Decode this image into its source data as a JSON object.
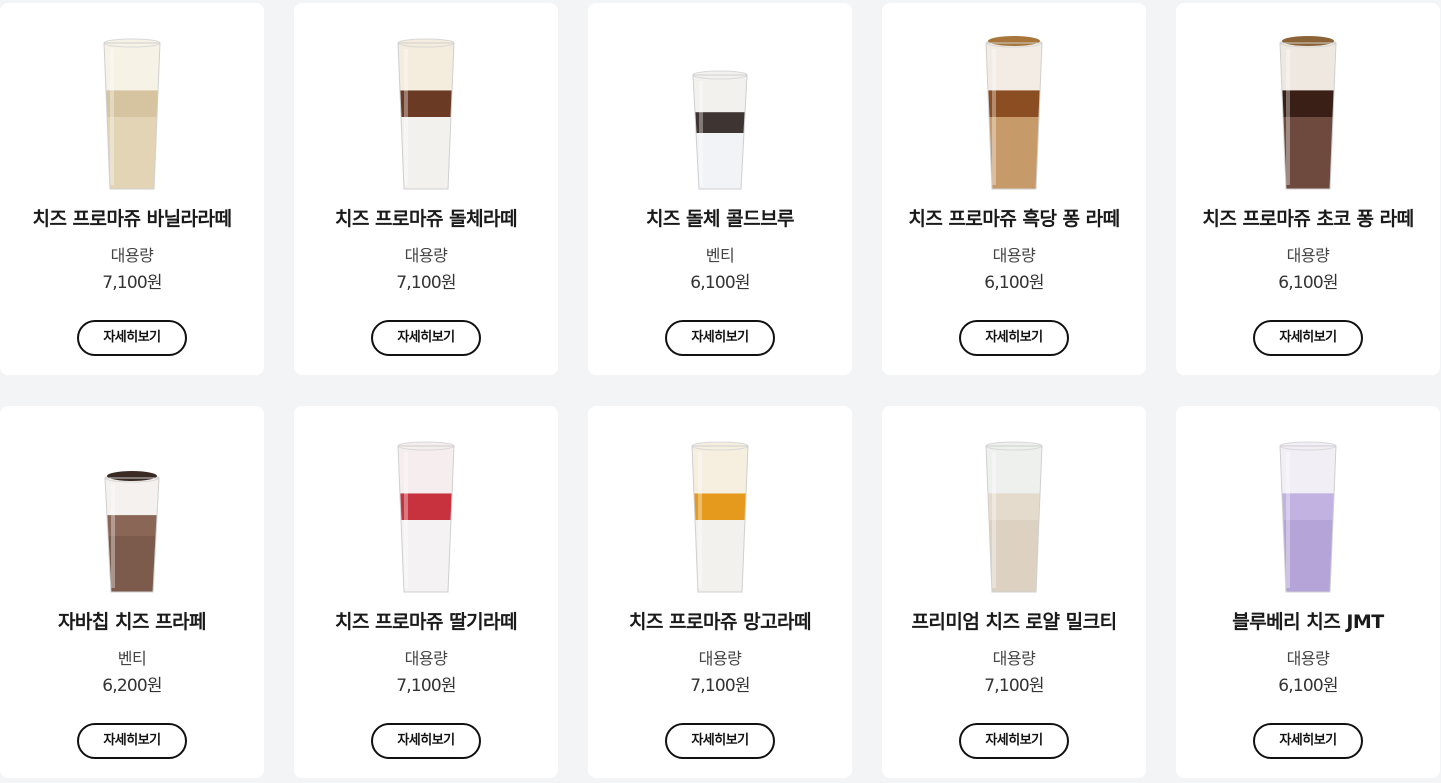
{
  "products": [
    {
      "name": "치즈 프로마쥬 바닐라라떼",
      "size": "대용량",
      "price": "7,100원",
      "button": "자세히보기",
      "cup": "tall",
      "colors": {
        "base": "#e2d4b4",
        "mid": "#d6c4a0",
        "top": "#f6f2e6",
        "topping": "none"
      }
    },
    {
      "name": "치즈 프로마쥬 돌체라떼",
      "size": "대용량",
      "price": "7,100원",
      "button": "자세히보기",
      "cup": "tall",
      "colors": {
        "base": "#f3f1ee",
        "mid": "#6b3a24",
        "top": "#f4ecdc",
        "topping": "none"
      }
    },
    {
      "name": "치즈 돌체 콜드브루",
      "size": "벤티",
      "price": "6,100원",
      "button": "자세히보기",
      "cup": "short",
      "colors": {
        "base": "#f1f3f6",
        "mid": "#3e3431",
        "top": "#f3f1ee",
        "topping": "none"
      }
    },
    {
      "name": "치즈 프로마쥬 흑당 퐁 라떼",
      "size": "대용량",
      "price": "6,100원",
      "button": "자세히보기",
      "cup": "tall",
      "colors": {
        "base": "#c79a6a",
        "mid": "#8a4e22",
        "top": "#f2ece4",
        "topping": "#a8763a"
      }
    },
    {
      "name": "치즈 프로마쥬 초코 퐁 라떼",
      "size": "대용량",
      "price": "6,100원",
      "button": "자세히보기",
      "cup": "tall",
      "colors": {
        "base": "#6e4a3e",
        "mid": "#3a1f16",
        "top": "#efe8e0",
        "topping": "#8c6336"
      }
    },
    {
      "name": "자바칩 치즈 프라페",
      "size": "벤티",
      "price": "6,200원",
      "button": "자세히보기",
      "cup": "short",
      "colors": {
        "base": "#7c5a4c",
        "mid": "#8a6656",
        "top": "#f5f1ee",
        "topping": "#3a2a24"
      }
    },
    {
      "name": "치즈 프로마쥬 딸기라떼",
      "size": "대용량",
      "price": "7,100원",
      "button": "자세히보기",
      "cup": "tall",
      "colors": {
        "base": "#f4f2f2",
        "mid": "#c8323e",
        "top": "#f6eeee",
        "topping": "none"
      }
    },
    {
      "name": "치즈 프로마쥬 망고라떼",
      "size": "대용량",
      "price": "7,100원",
      "button": "자세히보기",
      "cup": "tall",
      "colors": {
        "base": "#f3f1ee",
        "mid": "#e59a1e",
        "top": "#f6efe0",
        "topping": "none"
      }
    },
    {
      "name": "프리미엄 치즈 로얄 밀크티",
      "size": "대용량",
      "price": "7,100원",
      "button": "자세히보기",
      "cup": "tall",
      "colors": {
        "base": "#ddd2c2",
        "mid": "#e4dbcc",
        "top": "#eef0ee",
        "topping": "none"
      }
    },
    {
      "name": "블루베리 치즈 JMT",
      "size": "대용량",
      "price": "6,100원",
      "button": "자세히보기",
      "cup": "tall",
      "colors": {
        "base": "#b4a4d8",
        "mid": "#c2b2e2",
        "top": "#f1eef6",
        "topping": "none"
      }
    }
  ]
}
